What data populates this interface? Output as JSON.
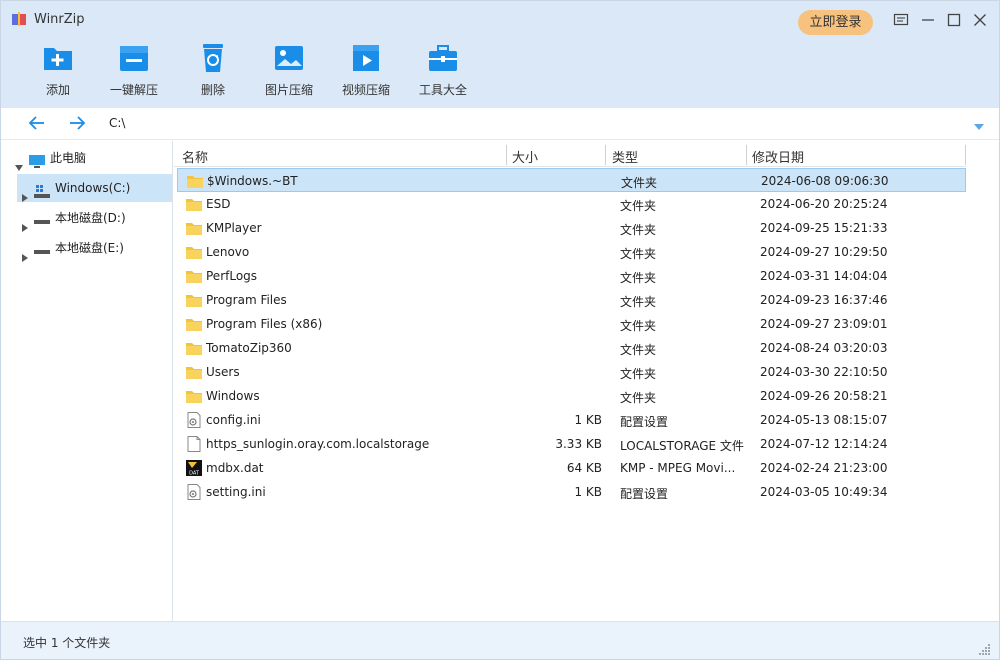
{
  "app": {
    "title": "WinrZip",
    "login_label": "立即登录"
  },
  "toolbar": [
    {
      "key": "add",
      "label": "添加",
      "icon": "add-folder-icon"
    },
    {
      "key": "extract",
      "label": "一键解压",
      "icon": "extract-icon"
    },
    {
      "key": "delete",
      "label": "删除",
      "icon": "recycle-bin-icon"
    },
    {
      "key": "image",
      "label": "图片压缩",
      "icon": "image-compress-icon"
    },
    {
      "key": "video",
      "label": "视频压缩",
      "icon": "video-compress-icon"
    },
    {
      "key": "tools",
      "label": "工具大全",
      "icon": "toolbox-icon"
    }
  ],
  "address": {
    "path": "C:\\"
  },
  "tree": {
    "root": "此电脑",
    "drives": [
      {
        "label": "Windows(C:)",
        "selected": true
      },
      {
        "label": "本地磁盘(D:)",
        "selected": false
      },
      {
        "label": "本地磁盘(E:)",
        "selected": false
      }
    ]
  },
  "columns": {
    "name": "名称",
    "size": "大小",
    "type": "类型",
    "modified": "修改日期"
  },
  "files": [
    {
      "name": "$Windows.~BT",
      "size": "",
      "type": "文件夹",
      "modified": "2024-06-08 09:06:30",
      "kind": "folder",
      "selected": true
    },
    {
      "name": "ESD",
      "size": "",
      "type": "文件夹",
      "modified": "2024-06-20 20:25:24",
      "kind": "folder"
    },
    {
      "name": "KMPlayer",
      "size": "",
      "type": "文件夹",
      "modified": "2024-09-25 15:21:33",
      "kind": "folder"
    },
    {
      "name": "Lenovo",
      "size": "",
      "type": "文件夹",
      "modified": "2024-09-27 10:29:50",
      "kind": "folder"
    },
    {
      "name": "PerfLogs",
      "size": "",
      "type": "文件夹",
      "modified": "2024-03-31 14:04:04",
      "kind": "folder"
    },
    {
      "name": "Program Files",
      "size": "",
      "type": "文件夹",
      "modified": "2024-09-23 16:37:46",
      "kind": "folder"
    },
    {
      "name": "Program Files (x86)",
      "size": "",
      "type": "文件夹",
      "modified": "2024-09-27 23:09:01",
      "kind": "folder"
    },
    {
      "name": "TomatoZip360",
      "size": "",
      "type": "文件夹",
      "modified": "2024-08-24 03:20:03",
      "kind": "folder"
    },
    {
      "name": "Users",
      "size": "",
      "type": "文件夹",
      "modified": "2024-03-30 22:10:50",
      "kind": "folder"
    },
    {
      "name": "Windows",
      "size": "",
      "type": "文件夹",
      "modified": "2024-09-26 20:58:21",
      "kind": "folder"
    },
    {
      "name": "config.ini",
      "size": "1 KB",
      "type": "配置设置",
      "modified": "2024-05-13 08:15:07",
      "kind": "ini"
    },
    {
      "name": "https_sunlogin.oray.com.localstorage",
      "size": "3.33 KB",
      "type": "LOCALSTORAGE 文件",
      "modified": "2024-07-12 12:14:24",
      "kind": "file"
    },
    {
      "name": "mdbx.dat",
      "size": "64 KB",
      "type": "KMP - MPEG Movi...",
      "modified": "2024-02-24 21:23:00",
      "kind": "dat"
    },
    {
      "name": "setting.ini",
      "size": "1 KB",
      "type": "配置设置",
      "modified": "2024-03-05 10:49:34",
      "kind": "ini"
    }
  ],
  "status": {
    "text": "选中 1 个文件夹"
  },
  "colors": {
    "accent": "#1a8de8",
    "selection": "#cce4f7",
    "titlebar": "#dbe8f7",
    "folder": "#f5c33b",
    "login": "#f7c27e"
  }
}
